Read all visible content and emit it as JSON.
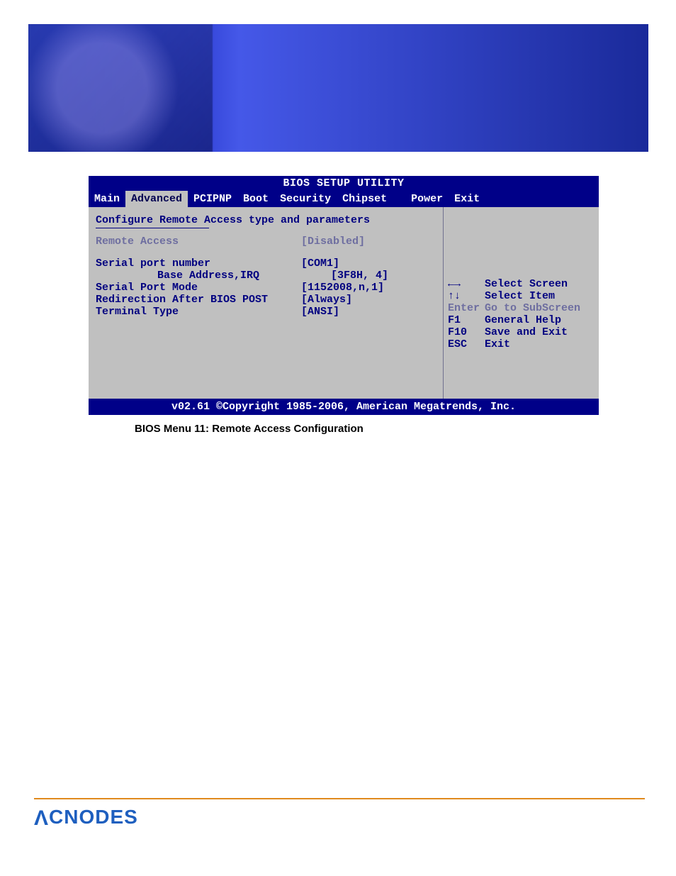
{
  "bios": {
    "title": "BIOS SETUP UTILITY",
    "tabs": [
      "Main",
      "Advanced",
      "PCIPNP",
      "Boot",
      "Security",
      "Chipset",
      "Power",
      "Exit"
    ],
    "active_tab": "Advanced",
    "section_heading": "Configure Remote Access type and parameters",
    "remote_access_label": "Remote Access",
    "remote_access_value": "[Disabled]",
    "settings": [
      {
        "label": "Serial port number",
        "value": "[COM1]"
      },
      {
        "label": "     Base Address,IRQ",
        "value": "[3F8H, 4]"
      },
      {
        "label": "Serial Port Mode",
        "value": "[1152008,n,1]"
      },
      {
        "label": "Redirection After BIOS POST",
        "value": "[Always]"
      },
      {
        "label": "Terminal Type",
        "value": "[ANSI]"
      }
    ],
    "help": [
      {
        "key": "←→",
        "text": "Select Screen"
      },
      {
        "key": "↑↓",
        "text": "Select Item"
      },
      {
        "key": "Enter",
        "text": "Go to SubScreen",
        "dim": true
      },
      {
        "key": "F1",
        "text": "General Help"
      },
      {
        "key": "F10",
        "text": "Save and Exit"
      },
      {
        "key": "ESC",
        "text": "Exit"
      }
    ],
    "footer": "v02.61 ©Copyright 1985-2006, American Megatrends, Inc."
  },
  "caption": "BIOS Menu 11: Remote Access Configuration",
  "brand": "CNODES"
}
